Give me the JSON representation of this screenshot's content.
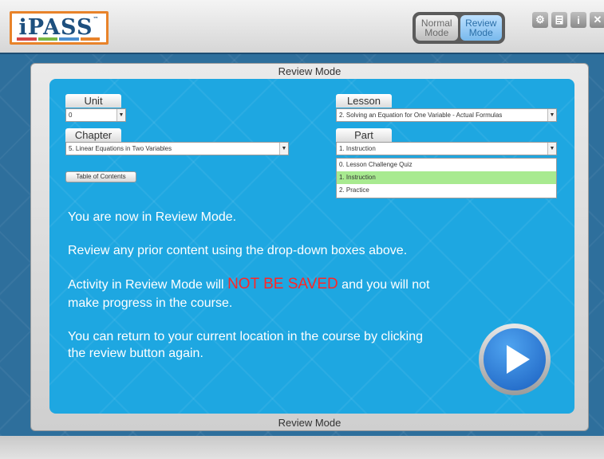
{
  "header": {
    "logo_text": "iPASS",
    "logo_tm": "™",
    "logo_colors": [
      "#d64545",
      "#79b843",
      "#4b8fd1",
      "#e8832a"
    ],
    "mode_toggle": {
      "normal_line1": "Normal",
      "normal_line2": "Mode",
      "review_line1": "Review",
      "review_line2": "Mode",
      "active": "review"
    },
    "icons": [
      "gear-icon",
      "notepad-icon",
      "info-icon",
      "close-icon"
    ]
  },
  "panel": {
    "title": "Review Mode",
    "footer": "Review Mode"
  },
  "selectors": {
    "unit": {
      "label": "Unit",
      "value": "0"
    },
    "lesson": {
      "label": "Lesson",
      "value": "2. Solving an Equation for One Variable - Actual Formulas"
    },
    "chapter": {
      "label": "Chapter",
      "value": "5. Linear Equations in Two Variables"
    },
    "part": {
      "label": "Part",
      "value": "1. Instruction",
      "options": [
        "0. Lesson Challenge Quiz",
        "1. Instruction",
        "2. Practice"
      ],
      "highlighted_index": 1
    },
    "toc_button": "Table of Contents"
  },
  "messages": {
    "line1": "You are now in Review Mode.",
    "line2": "Review any prior content using the drop-down boxes above.",
    "line3_pre": "Activity in Review Mode will ",
    "line3_warn": "NOT BE SAVED",
    "line3_post": " and you will not",
    "line4": "make progress in the course.",
    "line5": "You can return to your current location in the course by clicking",
    "line6": "the review button again."
  },
  "colors": {
    "content_blue": "#1ea7e1",
    "warning_red": "#ff2626",
    "highlight_green": "#a8ea90"
  }
}
